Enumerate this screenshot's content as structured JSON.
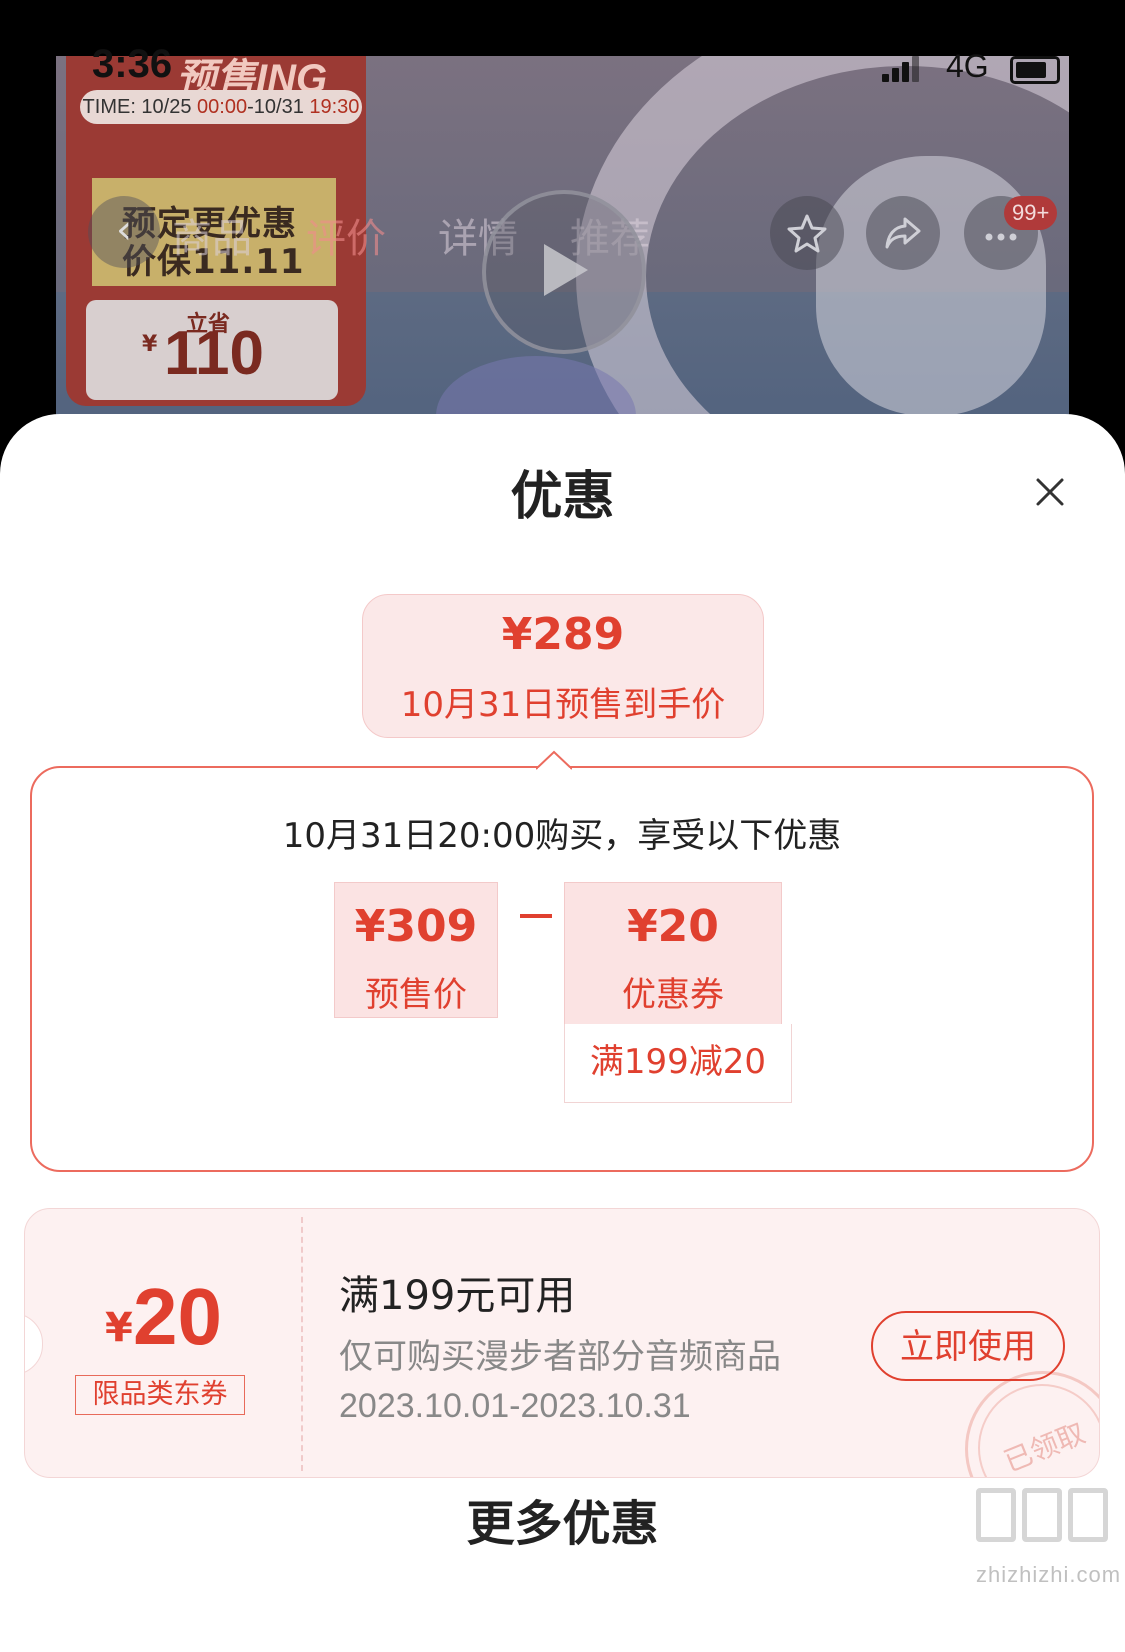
{
  "status_bar": {
    "time": "3:36",
    "network": "4G"
  },
  "background_page": {
    "promo_title": "预售ING",
    "promo_time_prefix": "TIME: 10/25 ",
    "promo_time_start": "00:00",
    "promo_time_mid": "-10/31 ",
    "promo_time_end": "19:30",
    "promo_line1": "预定更优惠",
    "promo_line2": "价保11.11",
    "promo_save_label": "立省",
    "promo_save_yen": "¥",
    "promo_save_amount": "110",
    "tabs": [
      "商品",
      "评价",
      "详情",
      "推荐"
    ],
    "badge": "99+"
  },
  "sheet": {
    "title": "优惠",
    "final_price": "¥289",
    "final_price_label": "10月31日预售到手价",
    "calc": {
      "heading": "10月31日20:00购买，享受以下优惠",
      "presale_price": "¥309",
      "presale_label": "预售价",
      "coupon_value": "¥20",
      "coupon_label": "优惠券",
      "coupon_rule": "满199减20"
    },
    "coupon": {
      "yen": "¥",
      "amount": "20",
      "tag": "限品类东券",
      "condition": "满199元可用",
      "scope": "仅可购买漫步者部分音频商品",
      "date_range": "2023.10.01-2023.10.31",
      "action": "立即使用",
      "stamp": "已领取"
    },
    "more_title": "更多优惠"
  },
  "watermark": "zhizhizhi.com",
  "colors": {
    "accent": "#e0402f",
    "pill_bg": "#fbe8e8",
    "border": "#ec6b5e"
  },
  "icons": [
    "back-icon",
    "play-icon",
    "star-icon",
    "share-icon",
    "more-icon",
    "close-icon"
  ]
}
